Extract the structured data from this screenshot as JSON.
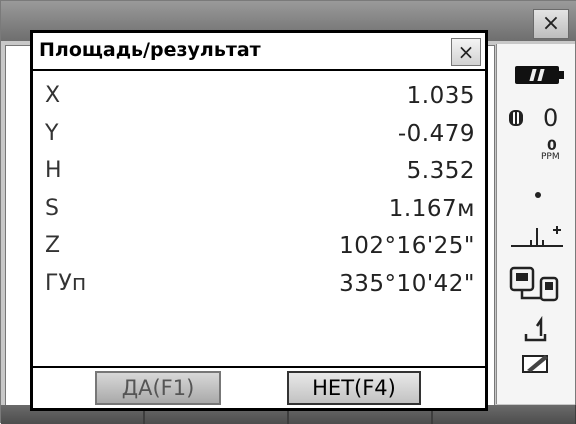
{
  "background_window": {
    "close_glyph": "×"
  },
  "dialog": {
    "title": "Площадь/результат",
    "close_glyph": "×",
    "rows": [
      {
        "label": "X",
        "value": "1.035"
      },
      {
        "label": "Y",
        "value": "-0.479"
      },
      {
        "label": "H",
        "value": "5.352"
      },
      {
        "label": "S",
        "value": "1.167м"
      },
      {
        "label": "Z",
        "value": "102°16'25\""
      },
      {
        "label": "ГУп",
        "value": "335°10'42\""
      }
    ],
    "buttons": {
      "yes_label": "ДА(F1)",
      "no_label": "НЕТ(F4)"
    }
  },
  "status": {
    "prism_constant": "0",
    "ppm_value": "0",
    "ppm_label": "PPM",
    "icons": [
      "battery-icon",
      "prism-icon",
      "ppm-icon",
      "dot-icon",
      "tilt-icon",
      "interface-icon",
      "rec-icon",
      "edit-icon"
    ]
  }
}
